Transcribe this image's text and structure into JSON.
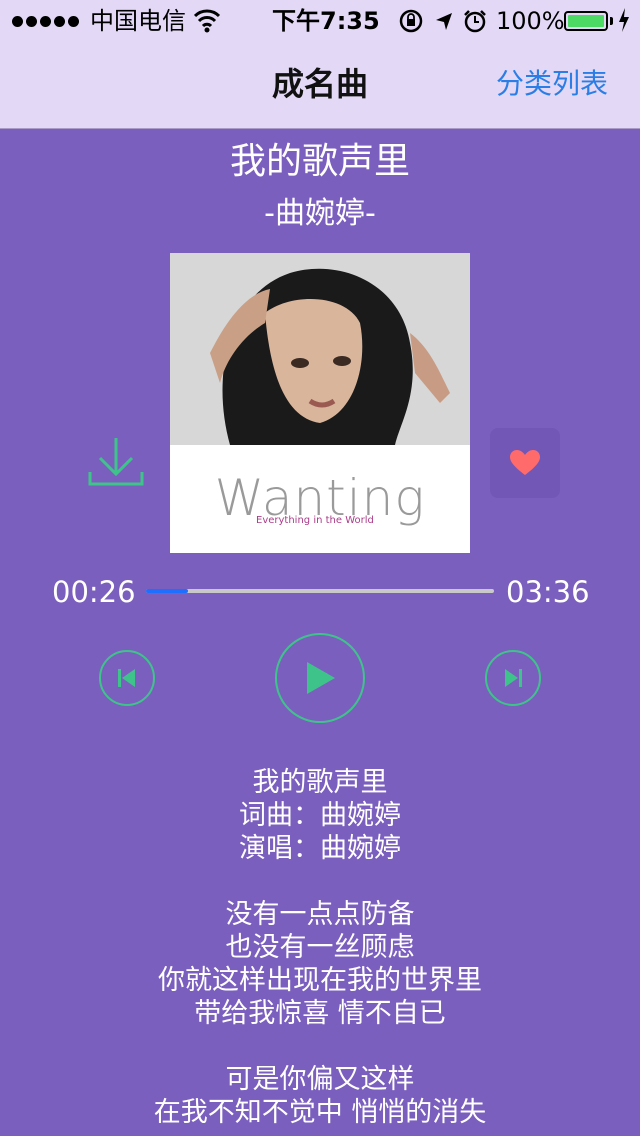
{
  "status_bar": {
    "carrier": "中国电信",
    "time": "下午7:35",
    "battery": "100%",
    "battery_level": 1.0,
    "icons": [
      "signal-dots-icon",
      "wifi-icon",
      "rotation-lock-icon",
      "location-icon",
      "alarm-icon",
      "battery-icon",
      "charging-icon"
    ]
  },
  "nav": {
    "title": "成名曲",
    "right_button": "分类列表"
  },
  "song": {
    "title": "我的歌声里",
    "artist": "-曲婉婷-"
  },
  "cover": {
    "logo": "Wanting",
    "subtitle": "Everything in the World"
  },
  "player": {
    "current_time": "00:26",
    "total_time": "03:36",
    "progress": 0.12,
    "accent": "#3ec48a",
    "progress_color": "#1f6fff",
    "favorite_color": "#ff6b6b"
  },
  "lyrics": [
    "我的歌声里",
    "词曲：曲婉婷",
    "演唱：曲婉婷",
    "",
    "没有一点点防备",
    "也没有一丝顾虑",
    "你就这样出现在我的世界里",
    "带给我惊喜 情不自已",
    "",
    "可是你偏又这样",
    "在我不知不觉中 悄悄的消失"
  ]
}
